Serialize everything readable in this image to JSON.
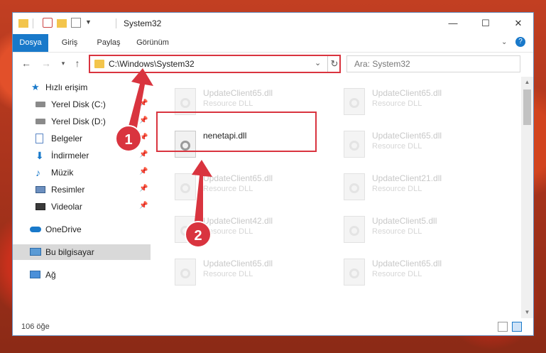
{
  "window": {
    "title": "System32",
    "controls": {
      "minimize": "—",
      "maximize": "☐",
      "close": "✕"
    }
  },
  "ribbon": {
    "tabs": [
      {
        "label": "Dosya",
        "active": true
      },
      {
        "label": "Giriş",
        "active": false
      },
      {
        "label": "Paylaş",
        "active": false
      },
      {
        "label": "Görünüm",
        "active": false
      }
    ],
    "help_label": "?"
  },
  "address": {
    "path": "C:\\Windows\\System32",
    "search_placeholder": "Ara: System32"
  },
  "sidebar": {
    "items": [
      {
        "label": "Hızlı erişim",
        "icon": "star-icon",
        "pinned": false
      },
      {
        "label": "Yerel Disk (C:)",
        "icon": "drive-icon",
        "pinned": true
      },
      {
        "label": "Yerel Disk (D:)",
        "icon": "drive-icon",
        "pinned": true
      },
      {
        "label": "Belgeler",
        "icon": "documents-icon",
        "pinned": true
      },
      {
        "label": "İndirmeler",
        "icon": "downloads-icon",
        "pinned": true
      },
      {
        "label": "Müzik",
        "icon": "music-icon",
        "pinned": true
      },
      {
        "label": "Resimler",
        "icon": "pictures-icon",
        "pinned": true
      },
      {
        "label": "Videolar",
        "icon": "videos-icon",
        "pinned": true
      },
      {
        "label": "OneDrive",
        "icon": "cloud-icon",
        "pinned": false
      },
      {
        "label": "Bu bilgisayar",
        "icon": "computer-icon",
        "pinned": false,
        "selected": true
      },
      {
        "label": "Ağ",
        "icon": "network-icon",
        "pinned": false
      }
    ]
  },
  "files": [
    {
      "name": "UpdateClient65.dll",
      "type": "Resource DLL"
    },
    {
      "name": "UpdateClient65.dll",
      "type": "Resource DLL"
    },
    {
      "name": "nenetapi.dll",
      "type": "",
      "highlighted": true
    },
    {
      "name": "UpdateClient65.dll",
      "type": "Resource DLL"
    },
    {
      "name": "UpdateClient65.dll",
      "type": "Resource DLL"
    },
    {
      "name": "UpdateClient21.dll",
      "type": "Resource DLL"
    },
    {
      "name": "UpdateClient42.dll",
      "type": "Resource DLL"
    },
    {
      "name": "UpdateClient5.dll",
      "type": "Resource DLL"
    },
    {
      "name": "UpdateClient65.dll",
      "type": "Resource DLL"
    },
    {
      "name": "UpdateClient65.dll",
      "type": "Resource DLL"
    }
  ],
  "status": {
    "item_count": "106 öğe"
  },
  "annotations": {
    "marker1": "1",
    "marker2": "2"
  },
  "colors": {
    "accent": "#1979ca",
    "annotation_red": "#d9343f"
  }
}
